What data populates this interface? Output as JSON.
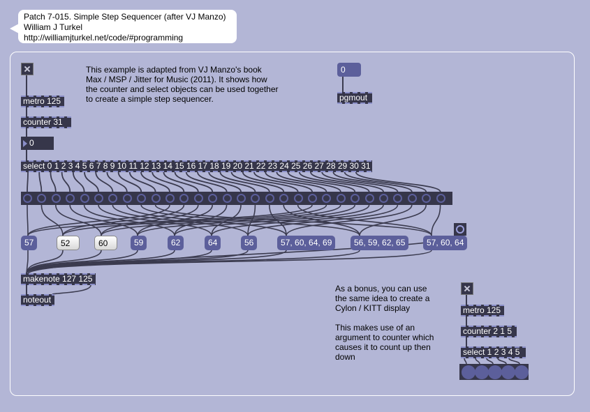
{
  "header": {
    "title": "Patch 7-015. Simple Step Sequencer (after VJ Manzo)",
    "author": "William J Turkel",
    "url": "http://williamjturkel.net/code/#programming"
  },
  "description": "This example is adapted from VJ Manzo's book\nMax / MSP / Jitter for Music (2011). It shows how\nthe counter and select objects can be used together\nto create a simple step sequencer.",
  "objects": {
    "metro": "metro 125",
    "counter": "counter 31",
    "counter_number": "0",
    "select": "select 0 1 2 3 4 5 6 7 8 9 10 11 12 13 14 15 16 17 18 19 20 21 22 23 24 25 26 27 28 29 30 31",
    "makenote": "makenote 127 125",
    "noteout": "noteout",
    "program_number": "0",
    "pgmout": "pgmout"
  },
  "messages": [
    "57",
    "52",
    "60",
    "59",
    "62",
    "64",
    "56",
    "57, 60, 64, 69",
    "56, 59, 62, 65",
    "57, 60, 64"
  ],
  "bonus": {
    "comment": "As a bonus, you can use\nthe same idea to create a\nCylon / KITT display\n\nThis makes use of an\nargument to counter which\ncauses it to count up then\ndown",
    "metro": "metro 125",
    "counter": "counter 2 1 5",
    "select": "select 1 2 3 4 5"
  },
  "colors": {
    "background": "#b3b6d6",
    "object_fill": "#36364a",
    "message_fill": "#5c5f9b",
    "patch_cord": "#3b3b4f"
  }
}
